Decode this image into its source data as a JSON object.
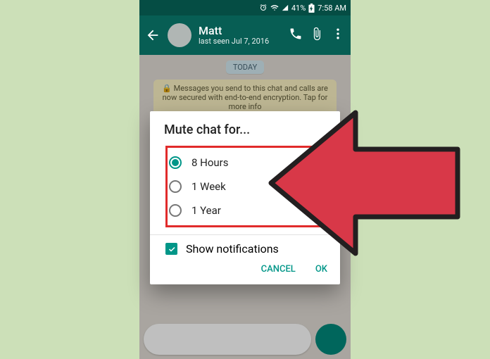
{
  "statusbar": {
    "battery": "41%",
    "time": "7:58 AM"
  },
  "chat": {
    "name": "Matt",
    "last_seen": "last seen Jul 7, 2016",
    "date_pill": "TODAY",
    "encryption": "🔒 Messages you send to this chat and calls are now secured with end-to-end encryption. Tap for more info"
  },
  "dialog": {
    "title": "Mute chat for...",
    "options": [
      "8 Hours",
      "1 Week",
      "1 Year"
    ],
    "show_notifications": "Show notifications",
    "cancel": "CANCEL",
    "ok": "OK"
  }
}
